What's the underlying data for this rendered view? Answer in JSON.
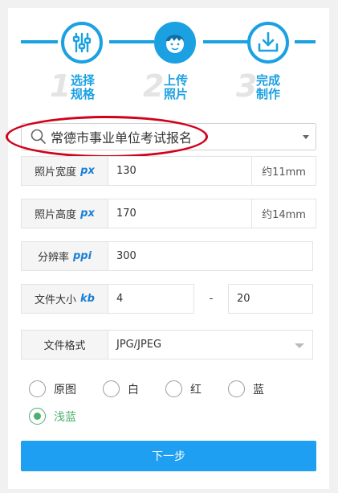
{
  "steps": [
    {
      "number": "1",
      "label_line1": "选择",
      "label_line2": "规格",
      "icon": "sliders-icon"
    },
    {
      "number": "2",
      "label_line1": "上传",
      "label_line2": "照片",
      "icon": "portrait-icon"
    },
    {
      "number": "3",
      "label_line1": "完成",
      "label_line2": "制作",
      "icon": "download-icon"
    }
  ],
  "search": {
    "value": "常德市事业单位考试报名"
  },
  "form": {
    "width": {
      "label": "照片宽度",
      "unit": "px",
      "value": "130",
      "note": "约11mm"
    },
    "height": {
      "label": "照片高度",
      "unit": "px",
      "value": "170",
      "note": "约14mm"
    },
    "resolution": {
      "label": "分辨率",
      "unit": "ppi",
      "value": "300"
    },
    "filesize": {
      "label": "文件大小",
      "unit": "kb",
      "min": "4",
      "separator": "-",
      "max": "20"
    },
    "format": {
      "label": "文件格式",
      "value": "JPG/JPEG"
    }
  },
  "background_colors": {
    "options": [
      "原图",
      "白",
      "红",
      "蓝",
      "浅蓝"
    ],
    "selected": "浅蓝"
  },
  "next_button": {
    "label": "下一步"
  },
  "colors": {
    "accent": "#1ba1e2",
    "button": "#1e9ff2",
    "selected": "#4caf6f",
    "highlight": "#d0021b"
  }
}
